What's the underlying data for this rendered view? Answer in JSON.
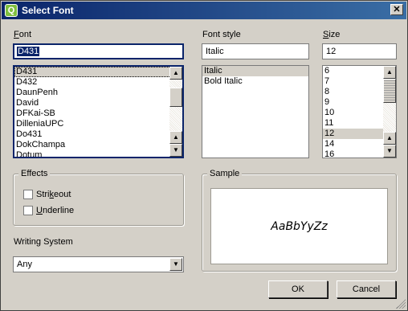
{
  "window": {
    "title": "Select Font",
    "app_icon": "Q",
    "close_glyph": "✕"
  },
  "font": {
    "label": "Font",
    "mnemonic": "F",
    "label_rest": "ont",
    "value": "D431",
    "items": [
      "D431",
      "D432",
      "DaunPenh",
      "David",
      "DFKai-SB",
      "DilleniaUPC",
      "Do431",
      "DokChampa",
      "Dotum"
    ]
  },
  "style": {
    "label": "Font style",
    "value": "Italic",
    "items": [
      "Italic",
      "Bold Italic"
    ]
  },
  "size": {
    "label": "Size",
    "mnemonic": "S",
    "label_rest": "ize",
    "value": "12",
    "items": [
      "6",
      "7",
      "8",
      "9",
      "10",
      "11",
      "12",
      "14",
      "16"
    ]
  },
  "effects": {
    "legend": "Effects",
    "strikeout": {
      "pre": "Stri",
      "mnemonic": "k",
      "post": "eout"
    },
    "underline": {
      "pre": "",
      "mnemonic": "U",
      "post": "nderline"
    }
  },
  "writing_system": {
    "label": "Writing System",
    "value": "Any"
  },
  "sample": {
    "legend": "Sample",
    "text": "AaBbYyZz"
  },
  "buttons": {
    "ok": "OK",
    "cancel": "Cancel"
  },
  "icons": {
    "scroll_up": "▲",
    "scroll_down": "▼",
    "combo_arrow": "▼"
  }
}
